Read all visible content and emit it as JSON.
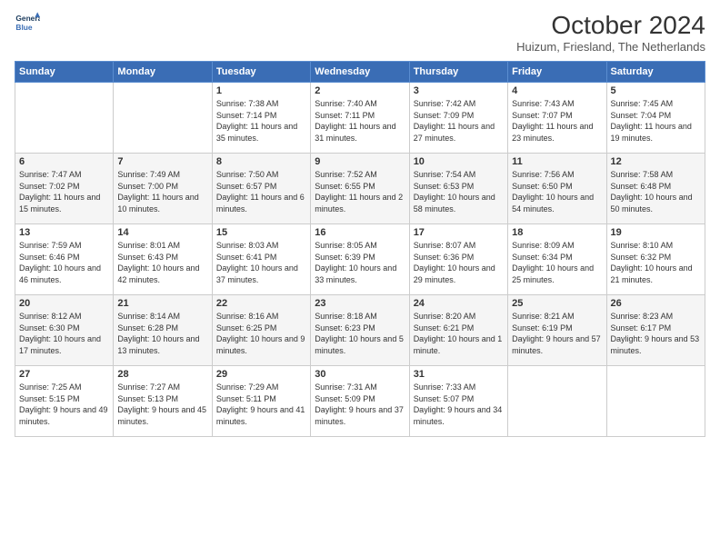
{
  "logo": {
    "line1": "General",
    "line2": "Blue"
  },
  "title": "October 2024",
  "subtitle": "Huizum, Friesland, The Netherlands",
  "days_of_week": [
    "Sunday",
    "Monday",
    "Tuesday",
    "Wednesday",
    "Thursday",
    "Friday",
    "Saturday"
  ],
  "weeks": [
    [
      {
        "day": "",
        "sunrise": "",
        "sunset": "",
        "daylight": ""
      },
      {
        "day": "",
        "sunrise": "",
        "sunset": "",
        "daylight": ""
      },
      {
        "day": "1",
        "sunrise": "Sunrise: 7:38 AM",
        "sunset": "Sunset: 7:14 PM",
        "daylight": "Daylight: 11 hours and 35 minutes."
      },
      {
        "day": "2",
        "sunrise": "Sunrise: 7:40 AM",
        "sunset": "Sunset: 7:11 PM",
        "daylight": "Daylight: 11 hours and 31 minutes."
      },
      {
        "day": "3",
        "sunrise": "Sunrise: 7:42 AM",
        "sunset": "Sunset: 7:09 PM",
        "daylight": "Daylight: 11 hours and 27 minutes."
      },
      {
        "day": "4",
        "sunrise": "Sunrise: 7:43 AM",
        "sunset": "Sunset: 7:07 PM",
        "daylight": "Daylight: 11 hours and 23 minutes."
      },
      {
        "day": "5",
        "sunrise": "Sunrise: 7:45 AM",
        "sunset": "Sunset: 7:04 PM",
        "daylight": "Daylight: 11 hours and 19 minutes."
      }
    ],
    [
      {
        "day": "6",
        "sunrise": "Sunrise: 7:47 AM",
        "sunset": "Sunset: 7:02 PM",
        "daylight": "Daylight: 11 hours and 15 minutes."
      },
      {
        "day": "7",
        "sunrise": "Sunrise: 7:49 AM",
        "sunset": "Sunset: 7:00 PM",
        "daylight": "Daylight: 11 hours and 10 minutes."
      },
      {
        "day": "8",
        "sunrise": "Sunrise: 7:50 AM",
        "sunset": "Sunset: 6:57 PM",
        "daylight": "Daylight: 11 hours and 6 minutes."
      },
      {
        "day": "9",
        "sunrise": "Sunrise: 7:52 AM",
        "sunset": "Sunset: 6:55 PM",
        "daylight": "Daylight: 11 hours and 2 minutes."
      },
      {
        "day": "10",
        "sunrise": "Sunrise: 7:54 AM",
        "sunset": "Sunset: 6:53 PM",
        "daylight": "Daylight: 10 hours and 58 minutes."
      },
      {
        "day": "11",
        "sunrise": "Sunrise: 7:56 AM",
        "sunset": "Sunset: 6:50 PM",
        "daylight": "Daylight: 10 hours and 54 minutes."
      },
      {
        "day": "12",
        "sunrise": "Sunrise: 7:58 AM",
        "sunset": "Sunset: 6:48 PM",
        "daylight": "Daylight: 10 hours and 50 minutes."
      }
    ],
    [
      {
        "day": "13",
        "sunrise": "Sunrise: 7:59 AM",
        "sunset": "Sunset: 6:46 PM",
        "daylight": "Daylight: 10 hours and 46 minutes."
      },
      {
        "day": "14",
        "sunrise": "Sunrise: 8:01 AM",
        "sunset": "Sunset: 6:43 PM",
        "daylight": "Daylight: 10 hours and 42 minutes."
      },
      {
        "day": "15",
        "sunrise": "Sunrise: 8:03 AM",
        "sunset": "Sunset: 6:41 PM",
        "daylight": "Daylight: 10 hours and 37 minutes."
      },
      {
        "day": "16",
        "sunrise": "Sunrise: 8:05 AM",
        "sunset": "Sunset: 6:39 PM",
        "daylight": "Daylight: 10 hours and 33 minutes."
      },
      {
        "day": "17",
        "sunrise": "Sunrise: 8:07 AM",
        "sunset": "Sunset: 6:36 PM",
        "daylight": "Daylight: 10 hours and 29 minutes."
      },
      {
        "day": "18",
        "sunrise": "Sunrise: 8:09 AM",
        "sunset": "Sunset: 6:34 PM",
        "daylight": "Daylight: 10 hours and 25 minutes."
      },
      {
        "day": "19",
        "sunrise": "Sunrise: 8:10 AM",
        "sunset": "Sunset: 6:32 PM",
        "daylight": "Daylight: 10 hours and 21 minutes."
      }
    ],
    [
      {
        "day": "20",
        "sunrise": "Sunrise: 8:12 AM",
        "sunset": "Sunset: 6:30 PM",
        "daylight": "Daylight: 10 hours and 17 minutes."
      },
      {
        "day": "21",
        "sunrise": "Sunrise: 8:14 AM",
        "sunset": "Sunset: 6:28 PM",
        "daylight": "Daylight: 10 hours and 13 minutes."
      },
      {
        "day": "22",
        "sunrise": "Sunrise: 8:16 AM",
        "sunset": "Sunset: 6:25 PM",
        "daylight": "Daylight: 10 hours and 9 minutes."
      },
      {
        "day": "23",
        "sunrise": "Sunrise: 8:18 AM",
        "sunset": "Sunset: 6:23 PM",
        "daylight": "Daylight: 10 hours and 5 minutes."
      },
      {
        "day": "24",
        "sunrise": "Sunrise: 8:20 AM",
        "sunset": "Sunset: 6:21 PM",
        "daylight": "Daylight: 10 hours and 1 minute."
      },
      {
        "day": "25",
        "sunrise": "Sunrise: 8:21 AM",
        "sunset": "Sunset: 6:19 PM",
        "daylight": "Daylight: 9 hours and 57 minutes."
      },
      {
        "day": "26",
        "sunrise": "Sunrise: 8:23 AM",
        "sunset": "Sunset: 6:17 PM",
        "daylight": "Daylight: 9 hours and 53 minutes."
      }
    ],
    [
      {
        "day": "27",
        "sunrise": "Sunrise: 7:25 AM",
        "sunset": "Sunset: 5:15 PM",
        "daylight": "Daylight: 9 hours and 49 minutes."
      },
      {
        "day": "28",
        "sunrise": "Sunrise: 7:27 AM",
        "sunset": "Sunset: 5:13 PM",
        "daylight": "Daylight: 9 hours and 45 minutes."
      },
      {
        "day": "29",
        "sunrise": "Sunrise: 7:29 AM",
        "sunset": "Sunset: 5:11 PM",
        "daylight": "Daylight: 9 hours and 41 minutes."
      },
      {
        "day": "30",
        "sunrise": "Sunrise: 7:31 AM",
        "sunset": "Sunset: 5:09 PM",
        "daylight": "Daylight: 9 hours and 37 minutes."
      },
      {
        "day": "31",
        "sunrise": "Sunrise: 7:33 AM",
        "sunset": "Sunset: 5:07 PM",
        "daylight": "Daylight: 9 hours and 34 minutes."
      },
      {
        "day": "",
        "sunrise": "",
        "sunset": "",
        "daylight": ""
      },
      {
        "day": "",
        "sunrise": "",
        "sunset": "",
        "daylight": ""
      }
    ]
  ]
}
